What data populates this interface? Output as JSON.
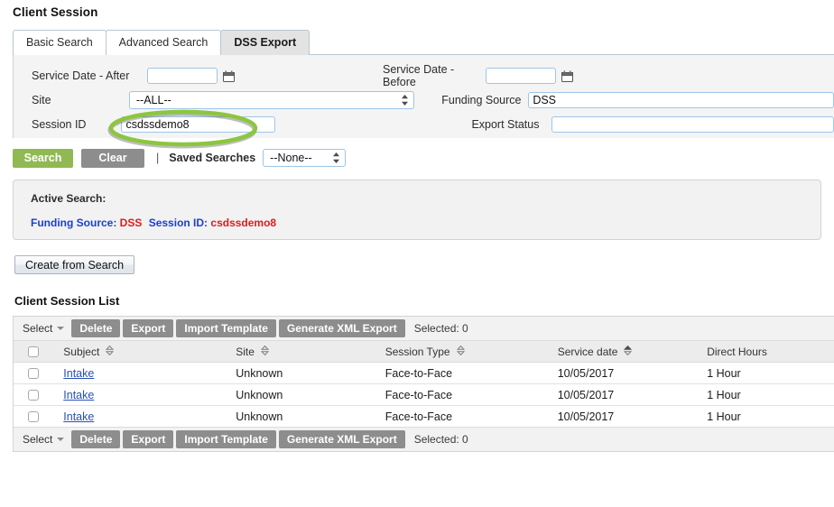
{
  "page": {
    "title": "Client Session"
  },
  "tabs": [
    {
      "label": "Basic Search",
      "active": false
    },
    {
      "label": "Advanced Search",
      "active": false
    },
    {
      "label": "DSS Export",
      "active": true
    }
  ],
  "search_form": {
    "left": {
      "service_date_after": {
        "label": "Service Date - After",
        "value": "",
        "placeholder": "",
        "icon": "calendar-icon"
      },
      "site": {
        "label": "Site",
        "value": "--ALL--",
        "options": [
          "--ALL--"
        ]
      },
      "session_id": {
        "label": "Session ID",
        "value": "csdssdemo8",
        "placeholder": ""
      }
    },
    "right": {
      "service_date_before": {
        "label": "Service Date - Before",
        "value": "",
        "placeholder": "",
        "icon": "calendar-icon"
      },
      "funding_source": {
        "label": "Funding Source",
        "value": "DSS",
        "placeholder": ""
      },
      "export_status": {
        "label": "Export Status",
        "value": "",
        "placeholder": ""
      }
    }
  },
  "actions": {
    "search_label": "Search",
    "clear_label": "Clear",
    "separator": "|",
    "saved_searches_label": "Saved Searches",
    "saved_searches_value": "--None--",
    "saved_searches_options": [
      "--None--"
    ],
    "create_from_search_label": "Create from Search"
  },
  "active_search": {
    "title": "Active Search:",
    "criteria": [
      {
        "key": "Funding Source:",
        "value": "DSS"
      },
      {
        "key": "Session ID:",
        "value": "csdssdemo8"
      }
    ]
  },
  "list": {
    "title": "Client Session List",
    "toolbar": {
      "select_label": "Select",
      "buttons": [
        "Delete",
        "Export",
        "Import Template",
        "Generate XML Export"
      ],
      "selected_label": "Selected: 0"
    },
    "columns": [
      {
        "label": "Subject",
        "sort": "none"
      },
      {
        "label": "Site",
        "sort": "none"
      },
      {
        "label": "Session Type",
        "sort": "none"
      },
      {
        "label": "Service date",
        "sort": "asc"
      },
      {
        "label": "Direct Hours",
        "sort": "none"
      }
    ],
    "rows": [
      {
        "subject": "Intake",
        "site": "Unknown",
        "session_type": "Face-to-Face",
        "service_date": "10/05/2017",
        "direct_hours": "1 Hour"
      },
      {
        "subject": "Intake",
        "site": "Unknown",
        "session_type": "Face-to-Face",
        "service_date": "10/05/2017",
        "direct_hours": "1 Hour"
      },
      {
        "subject": "Intake",
        "site": "Unknown",
        "session_type": "Face-to-Face",
        "service_date": "10/05/2017",
        "direct_hours": "1 Hour"
      }
    ]
  },
  "annotation": {
    "shape": "ellipse-highlight",
    "target": "session-id-input",
    "color": "#8cc63f"
  },
  "colors": {
    "search_button": "#90b954",
    "clear_button": "#8d8d8d",
    "toolbar_button": "#8d8d8d",
    "criteria_key": "#1a3fd4",
    "criteria_value": "#e01b1b",
    "link": "#2a4fb8",
    "annotation_green": "#8cc63f"
  }
}
